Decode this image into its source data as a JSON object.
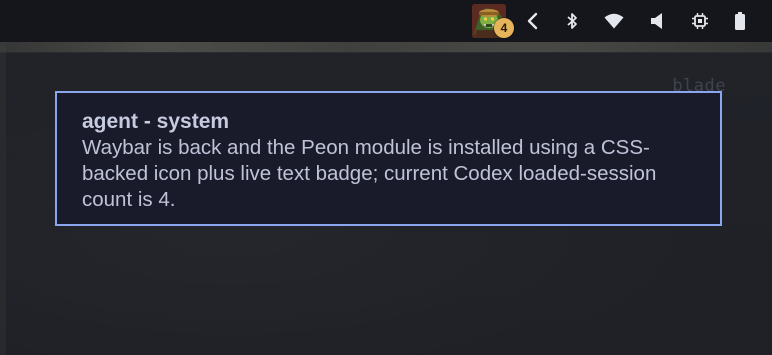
{
  "waybar": {
    "peon": {
      "icon": "peon-orc-icon",
      "count": "4"
    },
    "tray": [
      {
        "name": "tray-expand",
        "icon": "chevron-left-icon"
      },
      {
        "name": "bluetooth",
        "icon": "bluetooth-icon"
      },
      {
        "name": "wifi",
        "icon": "wifi-icon"
      },
      {
        "name": "volume",
        "icon": "speaker-icon"
      },
      {
        "name": "cpu",
        "icon": "cpu-chip-icon"
      },
      {
        "name": "battery",
        "icon": "battery-icon"
      }
    ]
  },
  "background_window": {
    "title": "blade"
  },
  "notification": {
    "summary": "agent - system",
    "body": "Waybar is back and the Peon module is installed using a CSS-backed icon plus live text badge; current Codex loaded-session count is 4.",
    "border_color": "#8aa6ef",
    "background_color": "#1a1b2a"
  }
}
